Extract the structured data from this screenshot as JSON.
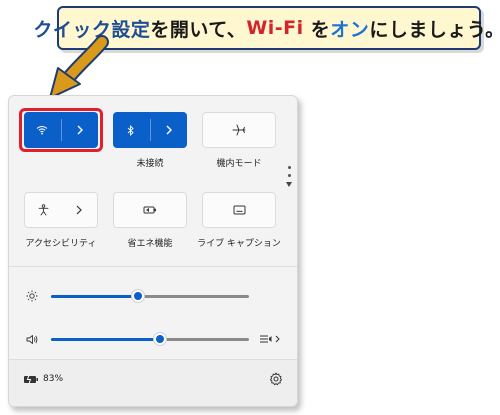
{
  "callout": {
    "part1": "クイック設定",
    "part2": "を開いて、",
    "part3": "Wi-Fi",
    "part4": " を",
    "part5": "オン",
    "part6": "にしましょう。"
  },
  "tiles": {
    "bluetooth_label": "未接続",
    "airplane_label": "機内モード",
    "accessibility_label": "アクセシビリティ",
    "battery_saver_label": "省エネ機能",
    "live_caption_label": "ライブ キャプション"
  },
  "sliders": {
    "brightness": 0.44,
    "volume": 0.55
  },
  "footer": {
    "battery_text": "83%"
  },
  "colors": {
    "accent": "#0a5fc8",
    "highlight": "#e0202a",
    "callout_text": "#1e4d94",
    "callout_red": "#d3242b",
    "callout_blue": "#1f73d4",
    "callout_bg": "#fff7cf"
  },
  "icons": [
    "wifi-icon",
    "bluetooth-icon",
    "airplane-icon",
    "accessibility-icon",
    "battery-saver-icon",
    "live-caption-icon",
    "brightness-icon",
    "volume-icon",
    "audio-output-icon",
    "battery-icon",
    "settings-gear-icon"
  ]
}
